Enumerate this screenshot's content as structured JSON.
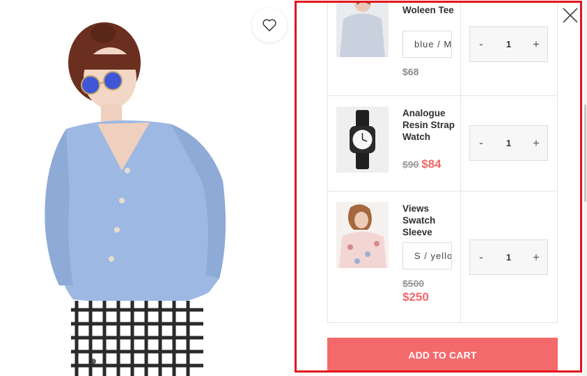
{
  "bundle": {
    "items": [
      {
        "name": "Woleen Tee",
        "variant": "blue / M",
        "regular_price": "$68",
        "quantity": "1",
        "qty_minus": "-",
        "qty_plus": "+",
        "image_icon": "sweater-photo-icon"
      },
      {
        "name": "Analogue Resin Strap Watch",
        "old_price": "$90",
        "sale_price": "$84",
        "quantity": "1",
        "qty_minus": "-",
        "qty_plus": "+",
        "image_icon": "watch-photo-icon"
      },
      {
        "name": "Views Swatch Sleeve",
        "variant": "S / yellow",
        "old_price": "$500",
        "sale_price": "$250",
        "quantity": "1",
        "qty_minus": "-",
        "qty_plus": "+",
        "image_icon": "blouse-photo-icon"
      }
    ],
    "add_to_cart_label": "ADD TO CART"
  },
  "colors": {
    "accent": "#f4696b",
    "sale_price": "#f06767",
    "highlight_border": "#e0171c"
  }
}
